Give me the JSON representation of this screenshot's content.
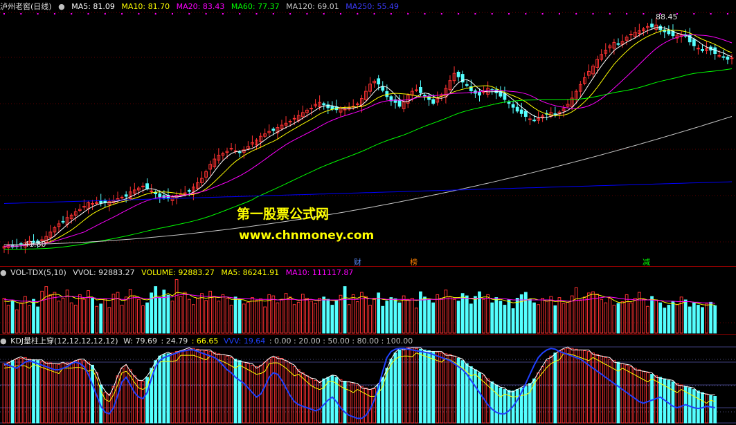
{
  "main_header": {
    "title": "泸州老窖(日线)",
    "ma5": "MA5: 81.09",
    "ma10": "MA10: 81.70",
    "ma20": "MA20: 83.43",
    "ma60": "MA60: 77.37",
    "ma120": "MA120: 69.01",
    "ma250": "MA250: 55.49"
  },
  "vol_header": {
    "name": "VOL-TDX(5,10)",
    "vvol": "VVOL: 92883.27",
    "volume": "VOLUME: 92883.27",
    "ma5": "MA5: 86241.91",
    "ma10": "MA10: 111117.87"
  },
  "kdj_header": {
    "name": "KDJ量柱上穿(12,12,12,12,12)",
    "w": "W: 79.69",
    "v2": ": 24.79",
    "v3": ": 66.65",
    "vvv": "VVV: 19.64",
    "levels": ": 0.00 : 20.00 : 50.00 : 80.00 : 100.00"
  },
  "labels": {
    "high": "88.45",
    "low": "41.80"
  },
  "events": [
    {
      "text": "财",
      "color": "#5a8cff"
    },
    {
      "text": "榜",
      "color": "#ff8000"
    },
    {
      "text": "减",
      "color": "#00ff00"
    }
  ],
  "watermark": {
    "line1": "第一股票公式网",
    "line2": "www.chnmoney.com"
  },
  "colors": {
    "up": "#ff3232",
    "down": "#54ffff",
    "ma5": "#ffffff",
    "ma10": "#ffff00",
    "ma20": "#ff00ff",
    "ma60": "#00ff00",
    "ma120": "#c8c8c8",
    "ma250": "#0000ff"
  },
  "chart_data": {
    "type": "candlestick",
    "x": [
      "d1",
      "d2",
      "d3",
      "d4",
      "d5",
      "d6",
      "d7",
      "d8",
      "d9",
      "d10",
      "d11",
      "d12",
      "d13",
      "d14",
      "d15",
      "d16",
      "d17",
      "d18",
      "d19",
      "d20",
      "d21",
      "d22",
      "d23",
      "d24",
      "d25",
      "d26",
      "d27",
      "d28",
      "d29",
      "d30",
      "d31",
      "d32",
      "d33",
      "d34",
      "d35",
      "d36",
      "d37",
      "d38",
      "d39",
      "d40",
      "d41",
      "d42",
      "d43",
      "d44",
      "d45",
      "d46",
      "d47",
      "d48",
      "d49",
      "d50",
      "d51",
      "d52",
      "d53",
      "d54",
      "d55",
      "d56",
      "d57",
      "d58",
      "d59",
      "d60",
      "d61",
      "d62",
      "d63",
      "d64",
      "d65",
      "d66",
      "d67",
      "d68",
      "d69",
      "d70",
      "d71",
      "d72",
      "d73",
      "d74",
      "d75",
      "d76",
      "d77",
      "d78",
      "d79",
      "d80",
      "d81",
      "d82",
      "d83",
      "d84",
      "d85",
      "d86",
      "d87",
      "d88",
      "d89",
      "d90",
      "d91",
      "d92",
      "d93",
      "d94",
      "d95",
      "d96",
      "d97",
      "d98",
      "d99",
      "d100",
      "d101",
      "d102",
      "d103",
      "d104",
      "d105",
      "d106",
      "d107",
      "d108",
      "d109",
      "d110",
      "d111",
      "d112",
      "d113",
      "d114",
      "d115",
      "d116",
      "d117",
      "d118",
      "d119",
      "d120",
      "d121",
      "d122",
      "d123",
      "d124",
      "d125",
      "d126",
      "d127",
      "d128",
      "d129",
      "d130",
      "d131",
      "d132",
      "d133",
      "d134",
      "d135",
      "d136",
      "d137",
      "d138",
      "d139",
      "d140",
      "d141",
      "d142",
      "d143",
      "d144",
      "d145",
      "d146",
      "d147",
      "d148",
      "d149",
      "d150",
      "d151",
      "d152",
      "d153",
      "d154",
      "d155",
      "d156",
      "d157",
      "d158",
      "d159",
      "d160",
      "d161",
      "d162",
      "d163",
      "d164",
      "d165",
      "d166",
      "d167",
      "d168",
      "d169",
      "d170",
      "d171",
      "d172",
      "d173",
      "d174",
      "d175",
      "d176"
    ],
    "close": [
      42.1,
      42.4,
      42.0,
      42.2,
      42.5,
      42.9,
      43.2,
      43.0,
      42.8,
      43.5,
      44.2,
      45.1,
      46.0,
      46.8,
      47.2,
      48.1,
      48.6,
      49.3,
      49.8,
      50.4,
      51.2,
      51.0,
      51.3,
      51.1,
      51.2,
      51.4,
      51.7,
      52.0,
      52.3,
      52.5,
      53.4,
      53.8,
      54.2,
      54.6,
      54.1,
      53.6,
      53.0,
      52.4,
      52.2,
      52.1,
      52.4,
      52.7,
      52.9,
      53.2,
      53.5,
      54.4,
      55.3,
      56.2,
      57.6,
      59.1,
      60.2,
      61.0,
      61.3,
      61.8,
      62.4,
      61.9,
      61.6,
      62.1,
      62.8,
      63.6,
      64.1,
      64.9,
      65.4,
      65.9,
      66.1,
      66.7,
      67.2,
      67.6,
      68.0,
      68.6,
      69.2,
      69.8,
      70.3,
      70.7,
      71.5,
      71.9,
      71.4,
      70.8,
      70.5,
      70.4,
      70.7,
      70.5,
      70.8,
      71.1,
      71.6,
      72.7,
      74.2,
      75.7,
      76.3,
      75.7,
      74.4,
      73.1,
      72.2,
      71.9,
      71.1,
      72.0,
      73.4,
      74.2,
      74.5,
      73.9,
      73.3,
      72.5,
      71.7,
      72.7,
      73.5,
      74.8,
      76.4,
      77.9,
      77.2,
      76.1,
      75.4,
      74.3,
      73.8,
      73.4,
      74.1,
      74.8,
      74.5,
      73.9,
      73.2,
      72.5,
      71.7,
      70.9,
      70.1,
      69.6,
      69.0,
      68.5,
      68.2,
      68.6,
      69.1,
      69.5,
      69.8,
      69.5,
      69.9,
      70.6,
      71.5,
      72.8,
      74.2,
      75.6,
      77.0,
      78.3,
      79.4,
      80.8,
      81.8,
      82.7,
      83.6,
      84.3,
      83.9,
      84.5,
      85.4,
      86.0,
      86.4,
      86.7,
      87.1,
      87.6,
      87.5,
      87.9,
      86.9,
      86.5,
      86.1,
      85.7,
      85.8,
      85.9,
      85.6,
      84.4,
      83.6,
      83.1,
      82.6,
      83.1,
      82.7,
      82.0,
      81.6,
      81.3,
      80.8,
      81.1
    ],
    "high_label": 88.45,
    "low_label": 41.8,
    "ylim": [
      40.5,
      90.5
    ],
    "volume": [
      60,
      48,
      55,
      40,
      52,
      63,
      47,
      58,
      45,
      72,
      80,
      66,
      70,
      55,
      60,
      74,
      52,
      48,
      66,
      58,
      73,
      61,
      46,
      50,
      59,
      44,
      67,
      70,
      48,
      62,
      75,
      64,
      58,
      47,
      52,
      69,
      80,
      61,
      74,
      65,
      55,
      92,
      63,
      70,
      58,
      49,
      60,
      68,
      56,
      72,
      63,
      55,
      66,
      60,
      48,
      62,
      57,
      50,
      53,
      61,
      56,
      59,
      45,
      66,
      64,
      52,
      58,
      68,
      62,
      49,
      53,
      67,
      60,
      55,
      51,
      60,
      62,
      58,
      48,
      56,
      65,
      80,
      49,
      66,
      54,
      70,
      63,
      48,
      60,
      69,
      46,
      55,
      61,
      59,
      52,
      64,
      58,
      60,
      43,
      71,
      62,
      57,
      52,
      66,
      60,
      74,
      62,
      58,
      55,
      68,
      64,
      50,
      63,
      71,
      58,
      66,
      52,
      61,
      55,
      48,
      57,
      42,
      60,
      66,
      70,
      58,
      52,
      49,
      60,
      55,
      63,
      47,
      61,
      51,
      53,
      64,
      78,
      56,
      62,
      69,
      71,
      67,
      58,
      52,
      60,
      48,
      51,
      54,
      66,
      52,
      60,
      70,
      58,
      46,
      63,
      57,
      52,
      43,
      48,
      54,
      49,
      62,
      57,
      45,
      52,
      48,
      44,
      50,
      53,
      47
    ],
    "vol_ma5": [
      55,
      54,
      56,
      53,
      51,
      52,
      54,
      52,
      53,
      57,
      63,
      65,
      67,
      66,
      62,
      64,
      63,
      60,
      59,
      60,
      62,
      62,
      57,
      58,
      57,
      56,
      58,
      60,
      56,
      57,
      64,
      64,
      62,
      58,
      57,
      59,
      64,
      63,
      65,
      68,
      64,
      70,
      69,
      68,
      66,
      62,
      60,
      61,
      60,
      61,
      62,
      61,
      62,
      62,
      58,
      58,
      58,
      57,
      54,
      55,
      55,
      56,
      55,
      56,
      58,
      57,
      58,
      58,
      61,
      58,
      56,
      57,
      58,
      58,
      56,
      56,
      58,
      57,
      56,
      56,
      58,
      61,
      60,
      61,
      60,
      63,
      61,
      59,
      58,
      60,
      58,
      57,
      59,
      56,
      55,
      57,
      56,
      57,
      56,
      57,
      60,
      59,
      58,
      58,
      60,
      62,
      63,
      61,
      61,
      62,
      60,
      59,
      58,
      60,
      62,
      62,
      58,
      57,
      58,
      56,
      54,
      52,
      53,
      54,
      56,
      59,
      59,
      57,
      57,
      55,
      56,
      54,
      55,
      54,
      53,
      55,
      59,
      60,
      61,
      65,
      67,
      66,
      64,
      62,
      61,
      56,
      53,
      52,
      54,
      54,
      56,
      59,
      59,
      57,
      58,
      57,
      56,
      53,
      51,
      51,
      49,
      51,
      54,
      54,
      53,
      51,
      49,
      48,
      49,
      48
    ],
    "vol_ma10": [
      58,
      57,
      57,
      56,
      55,
      55,
      55,
      54,
      54,
      56,
      58,
      60,
      61,
      62,
      62,
      63,
      63,
      63,
      62,
      61,
      61,
      61,
      60,
      59,
      59,
      59,
      59,
      59,
      58,
      58,
      60,
      61,
      61,
      60,
      59,
      59,
      61,
      61,
      61,
      62,
      62,
      65,
      66,
      66,
      66,
      65,
      64,
      64,
      63,
      63,
      63,
      62,
      62,
      62,
      61,
      60,
      60,
      60,
      59,
      59,
      58,
      58,
      58,
      58,
      58,
      57,
      57,
      58,
      58,
      58,
      57,
      57,
      57,
      58,
      57,
      57,
      57,
      57,
      57,
      57,
      57,
      58,
      58,
      58,
      58,
      59,
      59,
      59,
      59,
      59,
      59,
      58,
      58,
      58,
      58,
      58,
      57,
      57,
      57,
      57,
      57,
      58,
      58,
      58,
      58,
      59,
      59,
      59,
      60,
      60,
      60,
      60,
      60,
      60,
      60,
      60,
      60,
      60,
      59,
      59,
      58,
      57,
      57,
      57,
      57,
      57,
      57,
      57,
      57,
      57,
      57,
      56,
      56,
      56,
      55,
      55,
      56,
      57,
      57,
      58,
      59,
      60,
      61,
      62,
      62,
      61,
      60,
      59,
      58,
      58,
      57,
      57,
      57,
      57,
      57,
      56,
      56,
      55,
      55,
      55,
      54,
      54,
      54,
      54,
      53,
      53,
      52,
      52,
      52,
      51
    ],
    "kdj_w": [
      78,
      80,
      82,
      84,
      85,
      86,
      84,
      83,
      82,
      81,
      80,
      79,
      78,
      77,
      78,
      79,
      80,
      82,
      83,
      82,
      80,
      76,
      66,
      50,
      40,
      38,
      48,
      62,
      72,
      75,
      70,
      62,
      56,
      55,
      60,
      72,
      82,
      88,
      90,
      91,
      92,
      94,
      95,
      96,
      97,
      98,
      97,
      96,
      95,
      94,
      93,
      91,
      90,
      88,
      86,
      84,
      82,
      80,
      78,
      76,
      74,
      76,
      80,
      84,
      86,
      87,
      85,
      82,
      78,
      74,
      70,
      66,
      62,
      58,
      56,
      55,
      58,
      60,
      62,
      60,
      57,
      55,
      54,
      52,
      50,
      48,
      46,
      44,
      45,
      50,
      60,
      72,
      84,
      92,
      96,
      98,
      99,
      99,
      98,
      97,
      96,
      95,
      94,
      93,
      92,
      91,
      90,
      88,
      85,
      82,
      78,
      74,
      70,
      66,
      62,
      58,
      54,
      50,
      46,
      44,
      43,
      42,
      44,
      46,
      48,
      52,
      58,
      66,
      74,
      82,
      88,
      92,
      95,
      97,
      98,
      98,
      97,
      96,
      95,
      94,
      92,
      90,
      88,
      86,
      84,
      82,
      80,
      78,
      76,
      74,
      72,
      70,
      68,
      66,
      64,
      62,
      60,
      58,
      56,
      54,
      52,
      50,
      48,
      46,
      44,
      42,
      40,
      38,
      36,
      35
    ],
    "kdj_vvv": [
      78,
      76,
      74,
      72,
      76,
      80,
      82,
      80,
      78,
      76,
      74,
      72,
      70,
      70,
      72,
      74,
      78,
      80,
      78,
      74,
      64,
      50,
      36,
      22,
      14,
      12,
      20,
      36,
      54,
      60,
      50,
      40,
      34,
      32,
      40,
      58,
      74,
      82,
      86,
      88,
      90,
      92,
      94,
      95,
      96,
      96,
      94,
      92,
      90,
      88,
      86,
      82,
      76,
      70,
      66,
      60,
      56,
      52,
      46,
      40,
      34,
      38,
      48,
      60,
      66,
      64,
      56,
      46,
      36,
      28,
      24,
      22,
      20,
      18,
      16,
      18,
      24,
      30,
      34,
      28,
      20,
      14,
      10,
      8,
      6,
      6,
      10,
      18,
      30,
      48,
      68,
      86,
      94,
      97,
      98,
      98,
      97,
      96,
      95,
      94,
      93,
      92,
      90,
      88,
      86,
      84,
      82,
      78,
      74,
      70,
      64,
      56,
      48,
      40,
      32,
      24,
      18,
      14,
      12,
      12,
      16,
      22,
      30,
      40,
      52,
      64,
      76,
      86,
      92,
      96,
      98,
      97,
      94,
      92,
      90,
      88,
      86,
      84,
      80,
      76,
      72,
      68,
      64,
      60,
      56,
      52,
      48,
      44,
      40,
      36,
      32,
      28,
      26,
      28,
      30,
      32,
      34,
      30,
      26,
      22,
      20,
      22,
      24,
      22,
      20,
      19,
      20,
      22,
      21,
      20
    ]
  }
}
